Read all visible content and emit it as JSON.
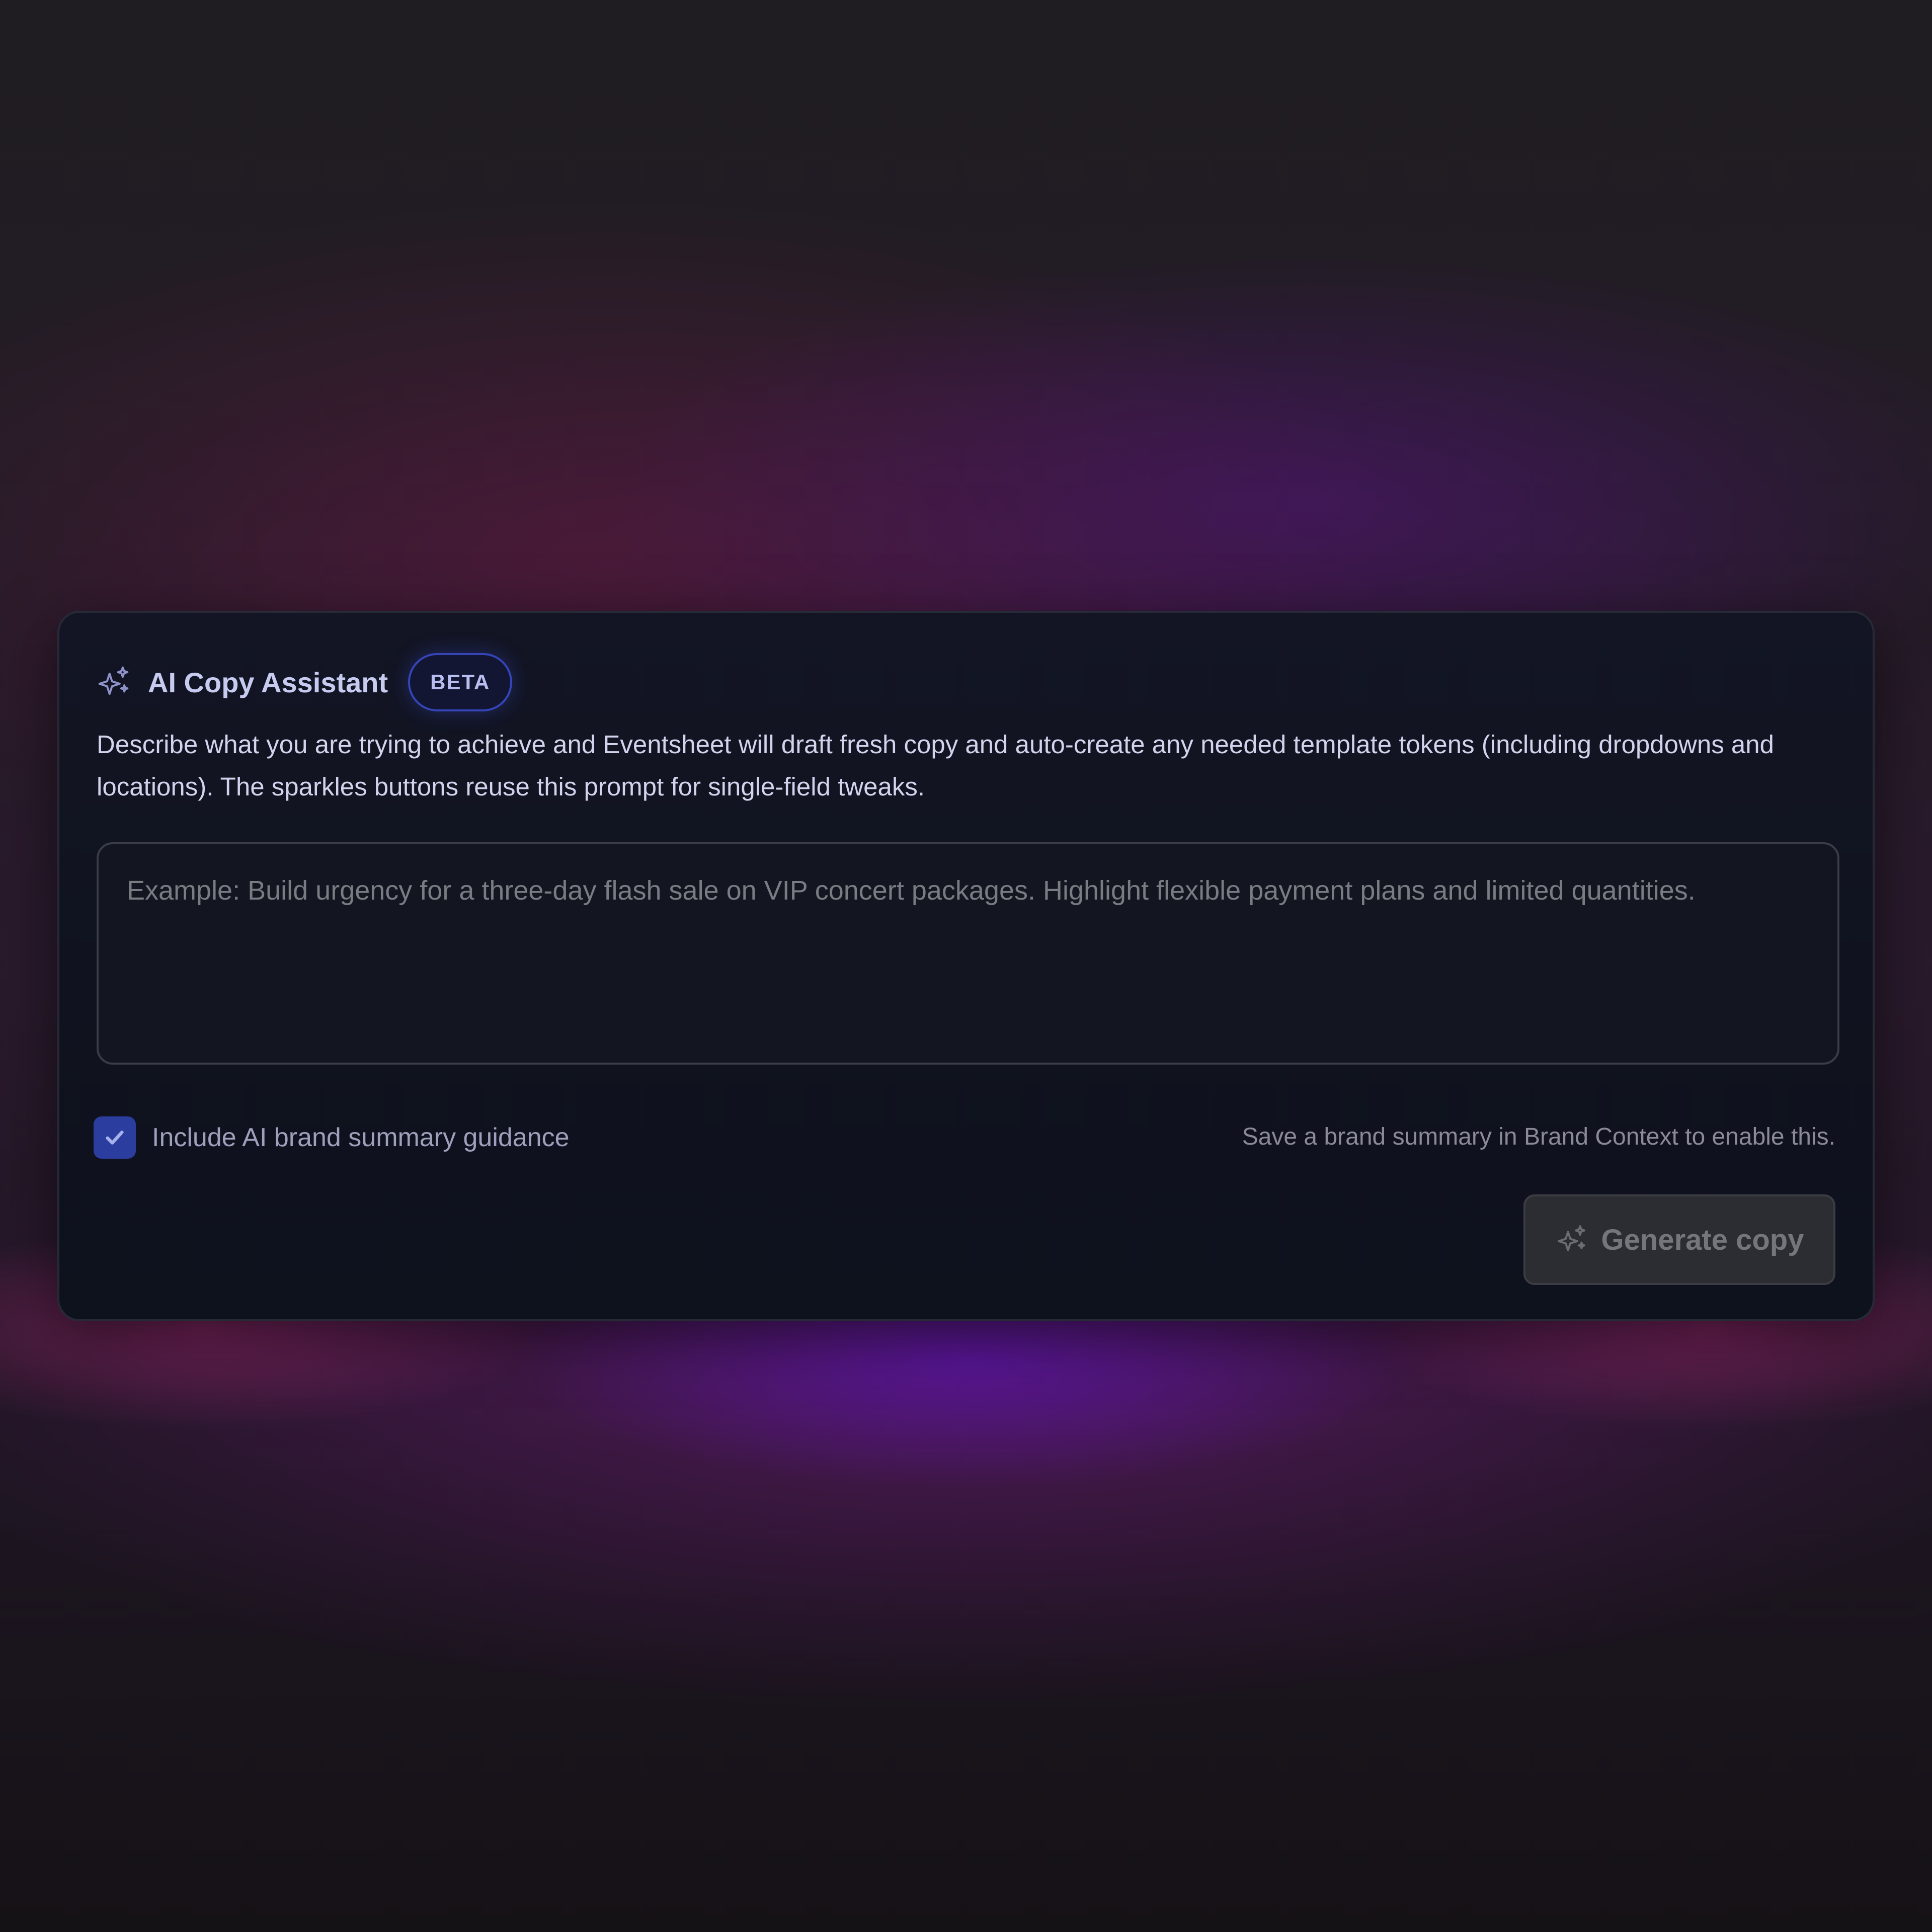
{
  "assistant": {
    "title": "AI Copy Assistant",
    "badge": "BETA",
    "description": "Describe what you are trying to achieve and Eventsheet will draft fresh copy and auto-create any needed template tokens (including dropdowns and locations). The sparkles buttons reuse this prompt for single-field tweaks.",
    "title_icon": "sparkles-icon"
  },
  "prompt": {
    "value": "",
    "placeholder": "Example: Build urgency for a three-day flash sale on VIP concert packages. Highlight flexible payment plans and limited quantities."
  },
  "brand_guidance": {
    "label": "Include AI brand summary guidance",
    "checked": true,
    "hint": "Save a brand summary in Brand Context to enable this."
  },
  "generate_button": {
    "label": "Generate copy",
    "icon": "sparkles-icon",
    "disabled": true
  },
  "colors": {
    "accent": "#2b3ea0",
    "badge_border": "#3545b8",
    "card_bg": "#10131f"
  }
}
